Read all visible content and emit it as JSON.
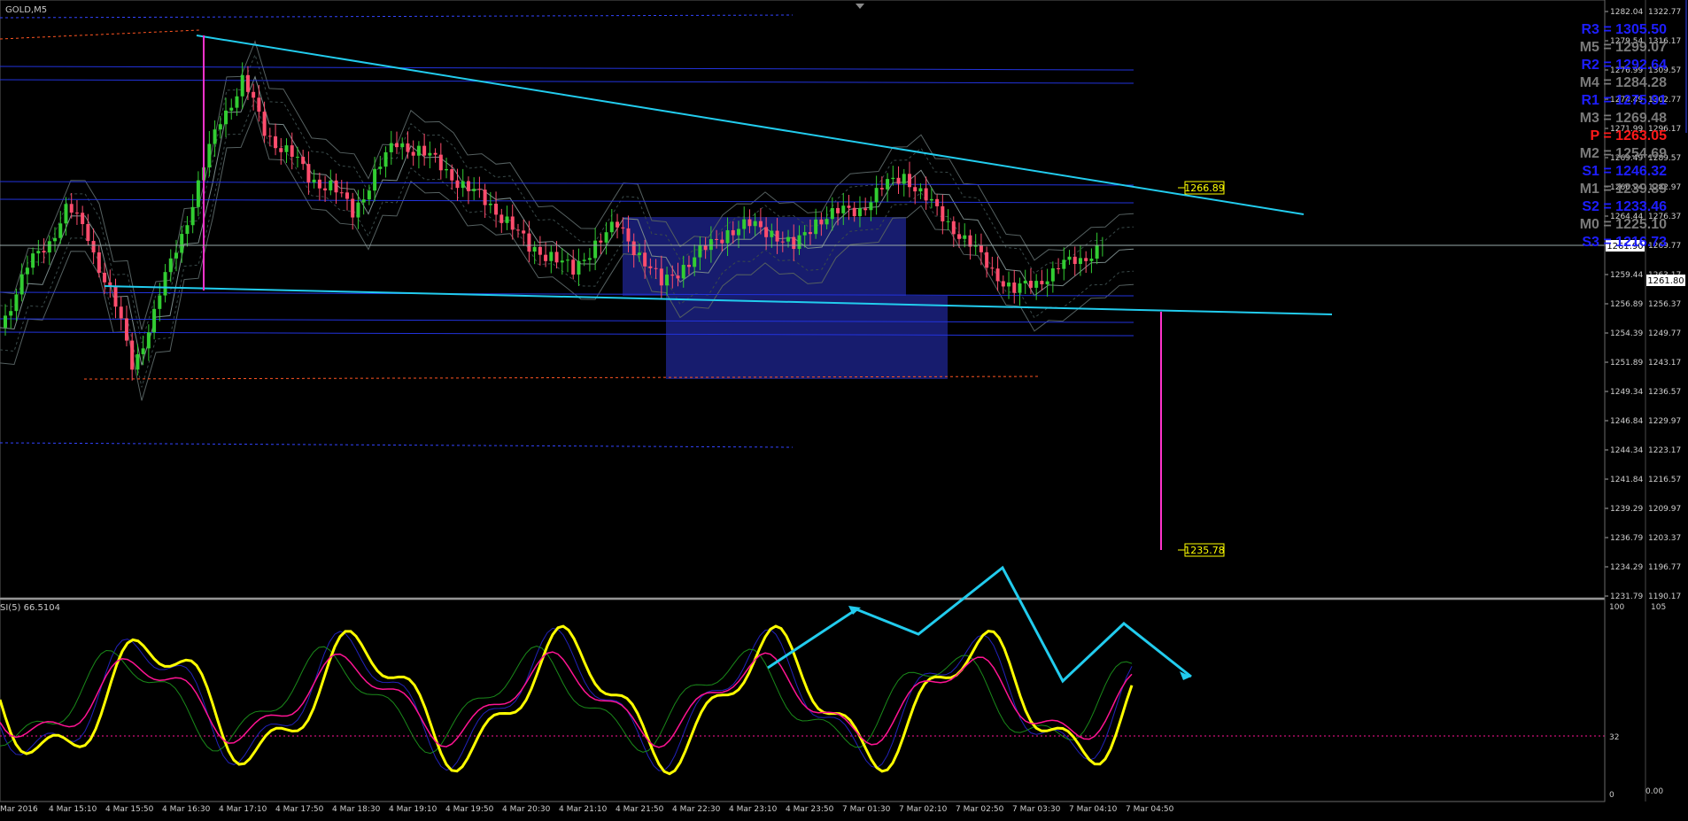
{
  "chart": {
    "symbol_label": "GOLD,M5",
    "indicator_label": "SI(5) 66.5104",
    "current_price_tag": "1261.90",
    "bid_tag": "1261.80",
    "target_upper": "1266.89",
    "target_lower": "1235.78"
  },
  "price_scale_inner": [
    "1282.04",
    "1279.54",
    "1276.99",
    "1274.49",
    "1271.99",
    "1269.49",
    "1266.94",
    "1264.44",
    "1261.90",
    "1259.44",
    "1256.89",
    "1254.39",
    "1251.89",
    "1249.34",
    "1246.84",
    "1244.34",
    "1241.84",
    "1239.29",
    "1236.79",
    "1234.29",
    "1231.79"
  ],
  "price_scale_outer": [
    "1322.77",
    "1316.17",
    "1309.57",
    "1302.77",
    "1296.17",
    "1289.57",
    "1282.97",
    "1276.37",
    "1269.77",
    "1263.17",
    "1256.37",
    "1249.77",
    "1243.17",
    "1236.57",
    "1229.97",
    "1223.17",
    "1216.57",
    "1209.97",
    "1203.37",
    "1196.77",
    "1190.17"
  ],
  "osc_scale": {
    "top": "100",
    "mid": "32",
    "bottom": "0",
    "outer_top": "105",
    "outer_bottom": "0.00"
  },
  "time_axis": [
    "Mar 2016",
    "4 Mar 15:10",
    "4 Mar 15:50",
    "4 Mar 16:30",
    "4 Mar 17:10",
    "4 Mar 17:50",
    "4 Mar 18:30",
    "4 Mar 19:10",
    "4 Mar 19:50",
    "4 Mar 20:30",
    "4 Mar 21:10",
    "4 Mar 21:50",
    "4 Mar 22:30",
    "4 Mar 23:10",
    "4 Mar 23:50",
    "7 Mar 01:30",
    "7 Mar 02:10",
    "7 Mar 02:50",
    "7 Mar 03:30",
    "7 Mar 04:10",
    "7 Mar 04:50"
  ],
  "pivots": [
    {
      "text": "R3 = 1305.50",
      "color": "#1e1eff"
    },
    {
      "text": "M5 = 1299.07",
      "color": "#7a7a7a"
    },
    {
      "text": "R2 = 1292.64",
      "color": "#1e1eff"
    },
    {
      "text": "M4 = 1284.28",
      "color": "#7a7a7a"
    },
    {
      "text": "R1 = 1275.91",
      "color": "#1e1eff"
    },
    {
      "text": "M3 = 1269.48",
      "color": "#7a7a7a"
    },
    {
      "text": "P  = 1263.05",
      "color": "#ff1a1a"
    },
    {
      "text": "M2 = 1254.69",
      "color": "#7a7a7a"
    },
    {
      "text": "S1 = 1246.32",
      "color": "#1e1eff"
    },
    {
      "text": "M1 = 1239.89",
      "color": "#7a7a7a"
    },
    {
      "text": "S2 = 1233.46",
      "color": "#1e1eff"
    },
    {
      "text": "M0 = 1225.10",
      "color": "#7a7a7a"
    },
    {
      "text": "S3 = 1216.73",
      "color": "#1e1eff"
    }
  ],
  "colors": {
    "bull": "#32cd32",
    "bear": "#ff4d6d",
    "trend": "#22ccee",
    "osc_main": "#ffff00",
    "osc_signal": "#ff1493",
    "box": "#1a1f7a"
  },
  "chart_data": {
    "type": "candlestick",
    "symbol": "GOLD",
    "timeframe": "M5",
    "ohlc_close_path": [
      1255,
      1259,
      1262,
      1265,
      1263,
      1258,
      1252,
      1256,
      1262,
      1267,
      1273,
      1276,
      1272,
      1270,
      1268,
      1267,
      1265,
      1268,
      1271,
      1270,
      1269,
      1267,
      1266,
      1264,
      1262,
      1261,
      1260,
      1262,
      1264,
      1261,
      1259,
      1260,
      1262,
      1263,
      1264,
      1263,
      1262,
      1264,
      1265,
      1265,
      1267,
      1268,
      1266,
      1264,
      1262,
      1260,
      1258,
      1259,
      1260,
      1261,
      1262
    ],
    "current_price": 1261.9,
    "oscillator": {
      "name": "SI(5)",
      "value": 66.5104,
      "levels": [
        100,
        32,
        0
      ]
    }
  }
}
